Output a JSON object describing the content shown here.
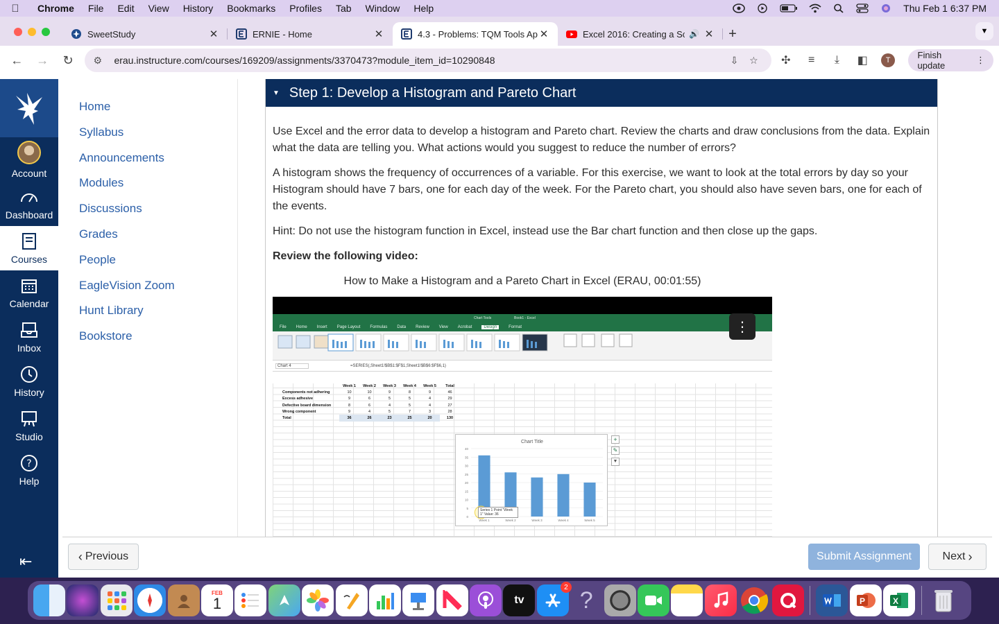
{
  "menubar": {
    "app": "Chrome",
    "items": [
      "File",
      "Edit",
      "View",
      "History",
      "Bookmarks",
      "Profiles",
      "Tab",
      "Window",
      "Help"
    ],
    "datetime": "Thu Feb 1  6:37 PM"
  },
  "tabs": [
    {
      "title": "SweetStudy",
      "icon": "sweetstudy-icon"
    },
    {
      "title": "ERNIE - Home",
      "icon": "ernie-icon"
    },
    {
      "title": "4.3 - Problems: TQM Tools Ap",
      "icon": "ernie-icon"
    },
    {
      "title": "Excel 2016: Creating a Sc",
      "icon": "youtube-icon"
    }
  ],
  "address": {
    "url": "erau.instructure.com/courses/169209/assignments/3370473?module_item_id=10290848",
    "profile_initial": "T",
    "finish_update": "Finish update"
  },
  "global_nav": {
    "items": [
      {
        "label": "Account"
      },
      {
        "label": "Dashboard"
      },
      {
        "label": "Courses"
      },
      {
        "label": "Calendar"
      },
      {
        "label": "Inbox"
      },
      {
        "label": "History"
      },
      {
        "label": "Studio"
      },
      {
        "label": "Help"
      }
    ]
  },
  "course_nav": [
    "Home",
    "Syllabus",
    "Announcements",
    "Modules",
    "Discussions",
    "Grades",
    "People",
    "EagleVision Zoom",
    "Hunt Library",
    "Bookstore"
  ],
  "step": {
    "title": "Step 1: Develop a Histogram and Pareto Chart",
    "p1": "Use Excel and the error data to develop a histogram and Pareto chart. Review the charts and draw conclusions from the data. Explain what the data are telling you. What actions would you suggest to reduce the number of errors?",
    "p2": "A histogram shows the frequency of occurrences of a variable. For this exercise, we want to look at the total errors by day so your Histogram should have 7 bars, one for each day of the week. For the Pareto chart, you should also have seven bars, one for each of the events.",
    "p3": "Hint: Do not use the histogram function in Excel, instead use the Bar chart function and then close up the gaps.",
    "review": "Review the following video:",
    "video_title": "How to Make a Histogram and a Pareto Chart in Excel (ERAU, 00:01:55)"
  },
  "video": {
    "excel_title": "Book1 - Excel",
    "chart_tools": "Chart Tools",
    "ribbon_tabs": [
      "File",
      "Home",
      "Insert",
      "Page Layout",
      "Formulas",
      "Data",
      "Review",
      "View",
      "Acrobat",
      "Design",
      "Format"
    ],
    "formula": "=SERIES(,Sheet1!$B$1:$F$1,Sheet1!$B$6:$F$6,1)",
    "name_box": "Chart 4",
    "table_header": [
      "",
      "Week 1",
      "Week 2",
      "Week 3",
      "Week 4",
      "Week 5",
      "Total"
    ],
    "table_rows": [
      [
        "Components not adhering",
        "10",
        "10",
        "9",
        "8",
        "9",
        "46"
      ],
      [
        "Excess adhesive",
        "9",
        "6",
        "5",
        "5",
        "4",
        "29"
      ],
      [
        "Defective board dimension",
        "8",
        "6",
        "4",
        "5",
        "4",
        "27"
      ],
      [
        "Wrong component",
        "9",
        "4",
        "5",
        "7",
        "3",
        "28"
      ],
      [
        "Total",
        "36",
        "26",
        "23",
        "25",
        "20",
        "130"
      ]
    ],
    "chart_title": "Chart Title",
    "tooltip": "Series 1 Point \"Week 1\" Value: 36"
  },
  "chart_data": {
    "type": "bar",
    "title": "Chart Title",
    "categories": [
      "Week 1",
      "Week 2",
      "Week 3",
      "Week 4",
      "Week 5"
    ],
    "values": [
      36,
      26,
      23,
      25,
      20
    ],
    "ylim": [
      0,
      40
    ],
    "yticks": [
      "0",
      "5",
      "10",
      "15",
      "20",
      "25",
      "30",
      "35",
      "40"
    ],
    "bar_color": "#5b9bd5"
  },
  "footer": {
    "previous": "Previous",
    "submit": "Submit Assignment",
    "next": "Next"
  },
  "dock": {
    "items": [
      "finder-icon",
      "siri-icon",
      "launchpad-icon",
      "safari-icon",
      "contacts-icon",
      "calendar-icon",
      "reminders-icon",
      "maps-icon",
      "photos-icon",
      "pages-icon",
      "numbers-icon",
      "keynote-icon",
      "news-icon",
      "podcasts-icon",
      "appletv-icon",
      "appstore-icon",
      "help-icon",
      "settings-icon",
      "facetime-icon",
      "notes-icon",
      "music-icon",
      "chrome-icon",
      "quizlet-icon",
      "word-icon",
      "powerpoint-icon",
      "excel-icon",
      "trash-icon"
    ],
    "calendar_month": "FEB",
    "calendar_day": "1",
    "appstore_badge": "2",
    "tv_label": "tv"
  },
  "colors": {
    "canvas_navy": "#0b2d5c",
    "link_blue": "#2b5fa8",
    "excel_green": "#217346",
    "submit_blue": "#8fb3dd"
  }
}
